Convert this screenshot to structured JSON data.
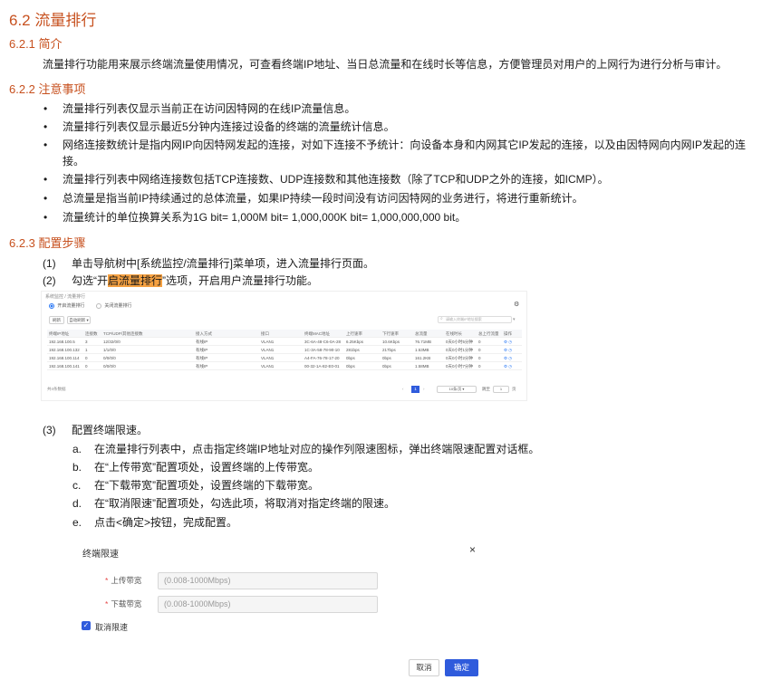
{
  "section": {
    "title": "6.2  流量排行",
    "intro": {
      "heading": "6.2.1  简介",
      "text": "流量排行功能用来展示终端流量使用情况，可查看终端IP地址、当日总流量和在线时长等信息，方便管理员对用户的上网行为进行分析与审计。"
    },
    "notes": {
      "heading": "6.2.2  注意事项",
      "bullet": "•",
      "items": [
        "流量排行列表仅显示当前正在访问因特网的在线IP流量信息。",
        "流量排行列表仅显示最近5分钟内连接过设备的终端的流量统计信息。",
        "网络连接数统计是指内网IP向因特网发起的连接，对如下连接不予统计：向设备本身和内网其它IP发起的连接，以及由因特网向内网IP发起的连接。",
        "流量排行列表中网络连接数包括TCP连接数、UDP连接数和其他连接数（除了TCP和UDP之外的连接，如ICMP）。",
        "总流量是指当前IP持续通过的总体流量，如果IP持续一段时间没有访问因特网的业务进行，将进行重新统计。",
        "流量统计的单位换算关系为1G bit= 1,000M bit= 1,000,000K bit= 1,000,000,000 bit。"
      ]
    },
    "config": {
      "heading": "6.2.3  配置步骤",
      "step1_num": "(1)",
      "step1": "单击导航树中[系统监控/流量排行]菜单项，进入流量排行页面。",
      "step2_num": "(2)",
      "step2_pre": "勾选“开",
      "step2_hl": "启流量排行",
      "step2_post": "”选项，开启用户流量排行功能。",
      "step3_num": "(3)",
      "step3": "配置终端限速。",
      "substeps": [
        {
          "num": "a.",
          "text": "在流量排行列表中，点击指定终端IP地址对应的操作列限速图标，弹出终端限速配置对话框。"
        },
        {
          "num": "b.",
          "text": "在“上传带宽”配置项处，设置终端的上传带宽。"
        },
        {
          "num": "c.",
          "text": "在“下载带宽”配置项处，设置终端的下载带宽。"
        },
        {
          "num": "d.",
          "text": "在“取消限速”配置项处，勾选此项，将取消对指定终端的限速。"
        },
        {
          "num": "e.",
          "text": "点击<确定>按钮，完成配置。"
        }
      ]
    }
  },
  "screenshot": {
    "breadcrumb": "系统监控 / 流量排行",
    "radio_on": "开启流量排行",
    "radio_off": "关闭流量排行",
    "btn_refresh": "刷新",
    "btn_auto": "自动刷新 ▾",
    "search_placeholder": "请输入终端IP地址搜索",
    "columns": [
      "终端IP地址",
      "连接数",
      "TCP/UDP/其他连接数",
      "接入方式",
      "接口",
      "终端MAC地址",
      "上行速率",
      "下行速率",
      "总流量",
      "在线时长",
      "总上行流量",
      "操作"
    ],
    "rows": [
      [
        "192.168.100.5",
        "3",
        "12/32/0/0",
        "有线IP",
        "VLAN1",
        "3C-6A-48-C6-0A-28",
        "6.25Kbps",
        "10.6Kbps",
        "76.71MB",
        "0天0小时5分钟",
        "0",
        "⚙ ◷"
      ],
      [
        "192.168.100.132",
        "1",
        "1/1/0/0",
        "有线IP",
        "VLAN1",
        "1C-3A-58-78-90-10",
        "281bps",
        "217bps",
        "1.53MB",
        "0天0小时1分钟",
        "0",
        "⚙ ◷"
      ],
      [
        "192.168.100.114",
        "0",
        "0/0/0/0",
        "有线IP",
        "VLAN1",
        "A4-FA-76-78-17-20",
        "0bps",
        "0bps",
        "161.2KB",
        "0天0小时2分钟",
        "0",
        "⚙ ◷"
      ],
      [
        "192.168.100.141",
        "0",
        "0/0/0/0",
        "有线IP",
        "VLAN1",
        "00-32-1A-82-E0-01",
        "0bps",
        "0bps",
        "1.58MB",
        "0天0小时7分钟",
        "0",
        "⚙ ◷"
      ]
    ],
    "total": "共4条数据",
    "page": "1",
    "page_size": "10条/页 ▾",
    "goto_label": "跳至",
    "goto_value": "1",
    "goto_unit": "页"
  },
  "dialog": {
    "title": "终端限速",
    "close": "×",
    "required_mark": "*",
    "upload_label": "上传带宽",
    "upload_placeholder": "(0.008-1000Mbps)",
    "download_label": "下载带宽",
    "download_placeholder": "(0.008-1000Mbps)",
    "cancel_limit_label": "取消限速",
    "cancel_limit_checked": true,
    "check_mark": "✓",
    "cancel_button": "取消",
    "ok_button": "确定",
    "accent_color": "#2f5bdc"
  },
  "colors": {
    "heading": "#c7511f",
    "highlight": "#f5a142"
  }
}
